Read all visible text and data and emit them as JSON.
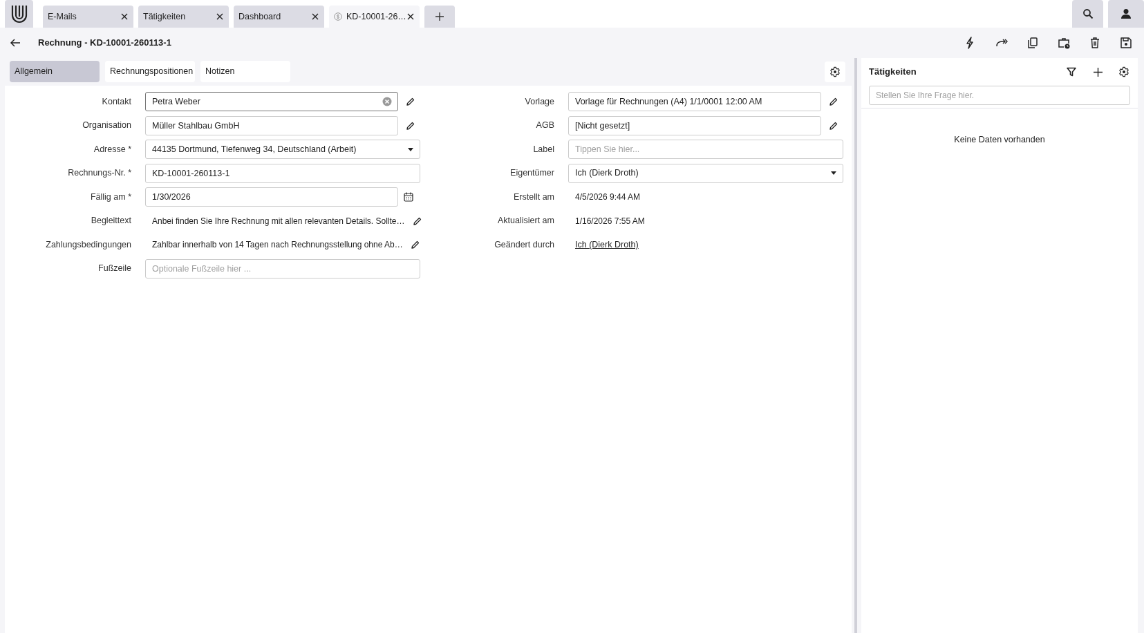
{
  "app_tabs": [
    {
      "label": "E-Mails",
      "selected": false,
      "kind": "view"
    },
    {
      "label": "Tätigkeiten",
      "selected": false,
      "kind": "view"
    },
    {
      "label": "Dashboard",
      "selected": false,
      "kind": "view"
    },
    {
      "label": "KD-10001-26…",
      "selected": true,
      "kind": "invoice"
    }
  ],
  "header": {
    "title": "Rechnung - KD-10001-260113-1"
  },
  "tabs": [
    {
      "label": "Allgemein",
      "selected": true
    },
    {
      "label": "Rechnungspositionen",
      "selected": false
    },
    {
      "label": "Notizen",
      "selected": false
    }
  ],
  "form_left": [
    {
      "label": "Kontakt",
      "kind": "text-field",
      "value": "Petra Weber",
      "clearable": true,
      "focused": true,
      "editable": true
    },
    {
      "label": "Organisation",
      "kind": "text-field",
      "value": "Müller Stahlbau GmbH",
      "editable": true
    },
    {
      "label": "Adresse *",
      "kind": "dropdown",
      "value": "44135 Dortmund, Tiefenweg 34, Deutschland (Arbeit)"
    },
    {
      "label": "Rechnungs-Nr. *",
      "kind": "text-field",
      "value": "KD-10001-260113-1"
    },
    {
      "label": "Fällig am *",
      "kind": "date-field",
      "value": "1/30/2026"
    },
    {
      "label": "Begleittext",
      "kind": "text",
      "value": "Anbei finden Sie Ihre Rechnung mit allen relevanten Details. Sollte…",
      "editable": true
    },
    {
      "label": "Zahlungsbedingungen",
      "kind": "text",
      "value": "Zahlbar innerhalb von 14 Tagen nach Rechnungsstellung ohne Ab…",
      "editable": true
    },
    {
      "label": "Fußzeile",
      "kind": "text-field",
      "placeholder": "Optionale Fußzeile hier ..."
    }
  ],
  "form_right": [
    {
      "label": "Vorlage",
      "kind": "text-field",
      "value": "Vorlage für Rechnungen (A4) 1/1/0001 12:00 AM",
      "editable": true
    },
    {
      "label": "AGB",
      "kind": "text-field",
      "value": "[Nicht gesetzt]",
      "editable": true
    },
    {
      "label": "Label",
      "kind": "text-field",
      "placeholder": "Tippen Sie hier..."
    },
    {
      "label": "Eigentümer",
      "kind": "dropdown",
      "value": "Ich (Dierk Droth)"
    },
    {
      "label": "Erstellt am",
      "kind": "text",
      "value": "4/5/2026 9:44 AM"
    },
    {
      "label": "Aktualisiert am",
      "kind": "text",
      "value": "1/16/2026 7:55 AM"
    },
    {
      "label": "Geändert durch",
      "kind": "link",
      "value": "Ich (Dierk Droth)"
    }
  ],
  "side_panel": {
    "title": "Tätigkeiten",
    "search": {
      "placeholder": "Stellen Sie Ihre Frage hier."
    },
    "empty_text": "Keine Daten vorhanden"
  }
}
